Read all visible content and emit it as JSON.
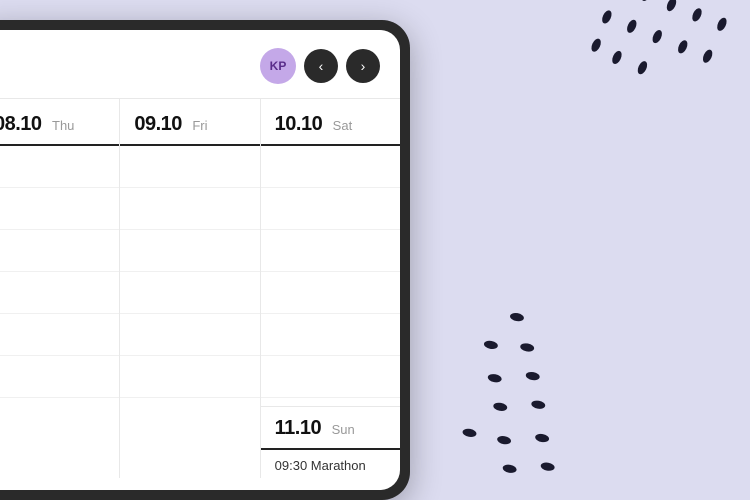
{
  "background_color": "#dcdcf0",
  "avatar": {
    "initials": "KP",
    "bg_color": "#c4a8e8",
    "text_color": "#5a2d8a"
  },
  "nav": {
    "prev_label": "‹",
    "next_label": "›"
  },
  "days": [
    {
      "date": "08.10",
      "day_name": "Thu",
      "events": []
    },
    {
      "date": "09.10",
      "day_name": "Fri",
      "events": []
    },
    {
      "date": "10.10",
      "day_name": "Sat",
      "events": []
    },
    {
      "date": "11.10",
      "day_name": "Sun",
      "events": [
        "09:30 Marathon"
      ]
    }
  ],
  "time_slots": 6
}
